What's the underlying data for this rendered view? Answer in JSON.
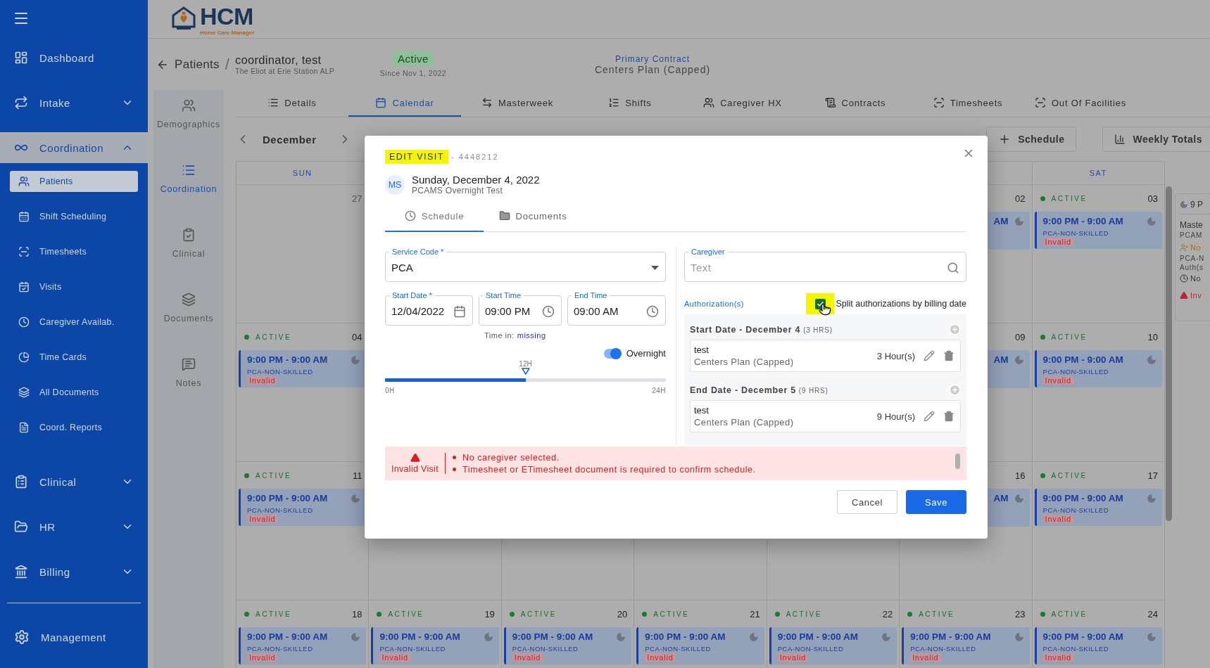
{
  "logo": {
    "title": "HCM",
    "tagline": "Home Care Manager"
  },
  "sidebar": {
    "items": [
      {
        "label": "Dashboard",
        "kind": "link",
        "selected": false
      },
      {
        "label": "Intake",
        "kind": "group",
        "selected": false,
        "expanded": false
      },
      {
        "label": "Coordination",
        "kind": "group",
        "selected": true,
        "expanded": true,
        "children": [
          {
            "label": "Patients",
            "selected": true
          },
          {
            "label": "Shift Scheduling",
            "selected": false
          },
          {
            "label": "Timesheets",
            "selected": false
          },
          {
            "label": "Visits",
            "selected": false
          },
          {
            "label": "Caregiver Availab.",
            "selected": false
          },
          {
            "label": "Time Cards",
            "selected": false
          },
          {
            "label": "All Documents",
            "selected": false
          },
          {
            "label": "Coord. Reports",
            "selected": false
          }
        ]
      },
      {
        "label": "Clinical",
        "kind": "group",
        "selected": false,
        "expanded": false
      },
      {
        "label": "HR",
        "kind": "group",
        "selected": false,
        "expanded": false
      },
      {
        "label": "Billing",
        "kind": "group",
        "selected": false,
        "expanded": false
      }
    ],
    "footer_item": "Management"
  },
  "patient": {
    "back_label": "Patients",
    "separator": "/",
    "name": "coordinator, test",
    "facility": "The Eliot at Erie Station ALP",
    "status": "Active",
    "since": "Since Nov 1, 2022"
  },
  "contract": {
    "label": "Primary Contract",
    "value": "Centers Plan (Capped)"
  },
  "subnav": [
    {
      "label": "Demographics",
      "selected": false
    },
    {
      "label": "Coordination",
      "selected": true
    },
    {
      "label": "Clinical",
      "selected": false
    },
    {
      "label": "Documents",
      "selected": false
    },
    {
      "label": "Notes",
      "selected": false
    }
  ],
  "tabs": [
    {
      "label": "Details",
      "selected": false
    },
    {
      "label": "Calendar",
      "selected": true
    },
    {
      "label": "Masterweek",
      "selected": false
    },
    {
      "label": "Shifts",
      "selected": false
    },
    {
      "label": "Caregiver HX",
      "selected": false
    },
    {
      "label": "Contracts",
      "selected": false
    },
    {
      "label": "Timesheets",
      "selected": false
    },
    {
      "label": "Out Of Facilities",
      "selected": false
    }
  ],
  "toolbar": {
    "month": "December",
    "buttons": [
      "Schedule",
      "Weekly Totals"
    ]
  },
  "calendar": {
    "headers": {
      "sun": "SUN",
      "sat": "SAT"
    },
    "weeks": [
      {
        "sun": {
          "date": "27",
          "outside_month": true
        },
        "fri": {
          "date": "02",
          "outside_month": false,
          "event": {
            "kind": "cut",
            "time": "AM"
          }
        },
        "sat": {
          "date": "03",
          "outside_month": false,
          "status": "ACTIVE",
          "event": {
            "kind": "full",
            "time": "9:00 PM - 9:00 AM",
            "service": "PCA-NON-SKILLED",
            "flag": "Invalid"
          }
        }
      },
      {
        "sun": {
          "date": "04",
          "outside_month": false,
          "status": "ACTIVE",
          "event": {
            "kind": "full",
            "time": "9:00 PM - 9:00 AM",
            "service": "PCA-NON-SKILLED",
            "flag": "Invalid"
          }
        },
        "fri": {
          "date": "09",
          "outside_month": false,
          "event": {
            "kind": "cut",
            "time": "AM"
          }
        },
        "sat": {
          "date": "10",
          "outside_month": false,
          "status": "ACTIVE",
          "event": {
            "kind": "full",
            "time": "9:00 PM - 9:00 AM",
            "service": "PCA-NON-SKILLED",
            "flag": "Invalid"
          }
        }
      },
      {
        "sun": {
          "date": "11",
          "outside_month": false,
          "status": "ACTIVE",
          "event": {
            "kind": "full",
            "time": "9:00 PM - 9:00 AM",
            "service": "PCA-NON-SKILLED",
            "flag": "Invalid"
          }
        },
        "fri": {
          "date": "16",
          "outside_month": false,
          "event": {
            "kind": "cut",
            "time": "AM"
          }
        },
        "sat": {
          "date": "17",
          "outside_month": false,
          "status": "ACTIVE",
          "event": {
            "kind": "full",
            "time": "9:00 PM - 9:00 AM",
            "service": "PCA-NON-SKILLED",
            "flag": "Invalid"
          }
        }
      },
      {
        "sun": {
          "date": "18",
          "outside_month": false,
          "status": "ACTIVE",
          "event": {
            "kind": "full",
            "time": "9:00 PM - 9:00 AM",
            "service": "PCA-NON-SKILLED",
            "flag": "Invalid"
          }
        },
        "mon": {
          "date": "19",
          "outside_month": false,
          "status": "ACTIVE",
          "event": {
            "kind": "full",
            "time": "9:00 PM - 9:00 AM",
            "service": "PCA-NON-SKILLED",
            "flag": "Invalid"
          }
        },
        "tue": {
          "date": "20",
          "outside_month": false,
          "status": "ACTIVE",
          "event": {
            "kind": "full",
            "time": "9:00 PM - 9:00 AM",
            "service": "PCA-NON-SKILLED",
            "flag": "Invalid"
          }
        },
        "wed": {
          "date": "21",
          "outside_month": false,
          "status": "ACTIVE",
          "event": {
            "kind": "full",
            "time": "9:00 PM - 9:00 AM",
            "service": "PCA-NON-SKILLED",
            "flag": "Invalid"
          }
        },
        "thu": {
          "date": "22",
          "outside_month": false,
          "status": "ACTIVE",
          "event": {
            "kind": "full",
            "time": "9:00 PM - 9:00 AM",
            "service": "PCA-NON-SKILLED",
            "flag": "Invalid"
          }
        },
        "fri": {
          "date": "23",
          "outside_month": false,
          "status": "ACTIVE",
          "event": {
            "kind": "full",
            "time": "9:00 PM - 9:00 AM",
            "service": "PCA-NON-SKILLED",
            "flag": "Invalid"
          }
        },
        "sat": {
          "date": "24",
          "outside_month": false,
          "status": "ACTIVE",
          "event": {
            "kind": "full",
            "time": "9:00 PM - 9:00 AM",
            "service": "PCA-NON-SKILLED",
            "flag": "Invalid"
          }
        }
      }
    ]
  },
  "side_panel": {
    "lines": [
      {
        "kind": "time",
        "text": "9 P"
      },
      {
        "kind": "title",
        "text": "Maste"
      },
      {
        "kind": "sub",
        "text": "PCAM"
      },
      {
        "kind": "warn",
        "text": "No"
      },
      {
        "kind": "sub",
        "text": "PCA-N"
      },
      {
        "kind": "sub",
        "text": "Auth(s"
      },
      {
        "kind": "clock",
        "text": "No"
      },
      {
        "kind": "error",
        "text": "Inv"
      }
    ]
  },
  "modal": {
    "title": "EDIT VISIT",
    "id_text": "- 4448212",
    "avatar": "MS",
    "date": "Sunday, December 4, 2022",
    "subtitle": "PCAMS Overnight Test",
    "tabs": [
      {
        "label": "Schedule",
        "selected": true
      },
      {
        "label": "Documents",
        "selected": false
      }
    ],
    "service_code": {
      "label": "Service Code *",
      "value": "PCA"
    },
    "start_date": {
      "label": "Start Date *",
      "value": "12/04/2022"
    },
    "start_time": {
      "label": "Start Time",
      "value": "09:00 PM"
    },
    "end_time": {
      "label": "End Time",
      "value": "09:00 AM"
    },
    "time_in": {
      "label": "Time in:",
      "value": "missing"
    },
    "overnight": {
      "label": "Overnight",
      "on": true
    },
    "timeline": {
      "level": 0.5,
      "marker_label": "12H",
      "min_label": "0H",
      "max_label": "24H"
    },
    "caregiver": {
      "label": "Caregiver",
      "placeholder": "Text"
    },
    "authorizations": {
      "label": "Authorization(s)",
      "split": {
        "label": "Split authorizations by billing date",
        "checked": true
      },
      "groups": [
        {
          "title": "Start Date - December 4",
          "note": "(3 HRS)",
          "entries": [
            {
              "name": "test",
              "plan": "Centers Plan (Capped)",
              "hours": "3 Hour(s)"
            }
          ]
        },
        {
          "title": "End Date - December 5",
          "note": "(9 HRS)",
          "entries": [
            {
              "name": "test",
              "plan": "Centers Plan (Capped)",
              "hours": "9 Hour(s)"
            }
          ]
        }
      ]
    },
    "error": {
      "title": "Invalid Visit",
      "messages": [
        "No caregiver selected.",
        "Timesheet or ETimesheet document is required to confirm schedule."
      ]
    },
    "buttons": [
      {
        "label": "Cancel",
        "kind": "secondary"
      },
      {
        "label": "Save",
        "kind": "primary"
      }
    ]
  }
}
